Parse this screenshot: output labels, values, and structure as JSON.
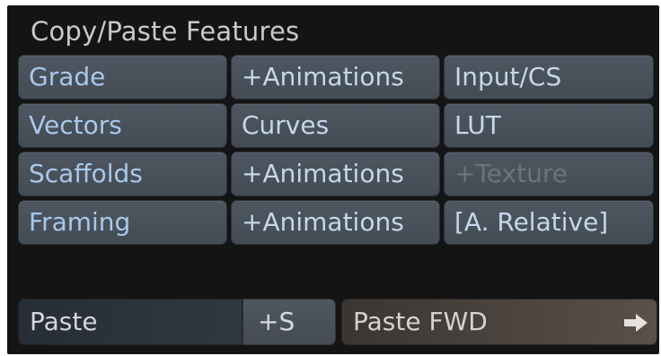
{
  "panel": {
    "title": "Copy/Paste Features"
  },
  "grid": {
    "rows": [
      [
        "Grade",
        "+Animations",
        "Input/CS"
      ],
      [
        "Vectors",
        "Curves",
        "LUT"
      ],
      [
        "Scaffolds",
        "+Animations",
        "+Texture"
      ],
      [
        "Framing",
        "+Animations",
        "[A. Relative]"
      ]
    ]
  },
  "bottom": {
    "paste_label": "Paste",
    "plus_s_label": "+S",
    "paste_fwd_label": "Paste FWD",
    "arrow_icon": "arrow-right-icon"
  },
  "colors": {
    "panel_bg": "#141414",
    "button_bg": "#4a525b",
    "text_blue": "#a9c8ea",
    "disabled_text": "#6d737a",
    "paste_fwd_bg": "#5a5049"
  }
}
